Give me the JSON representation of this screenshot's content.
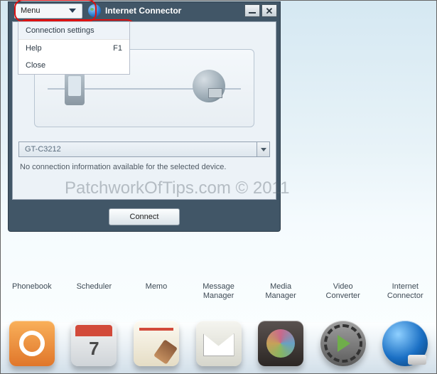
{
  "window": {
    "title": "Internet Connector",
    "menu_button_label": "Menu",
    "menu": {
      "items": [
        {
          "label": "Connection settings",
          "shortcut": ""
        },
        {
          "label": "Help",
          "shortcut": "F1"
        },
        {
          "label": "Close",
          "shortcut": ""
        }
      ]
    },
    "device_combo_value": "GT-C3212",
    "status_text": "No connection information available for the selected device.",
    "connect_button_label": "Connect"
  },
  "watermark": "PatchworkOfTips.com © 2011",
  "dock": {
    "items": [
      {
        "label": "Phonebook"
      },
      {
        "label": "Scheduler"
      },
      {
        "label": "Memo"
      },
      {
        "label": "Message\nManager"
      },
      {
        "label": "Media\nManager"
      },
      {
        "label": "Video\nConverter"
      },
      {
        "label": "Internet\nConnector"
      }
    ]
  }
}
